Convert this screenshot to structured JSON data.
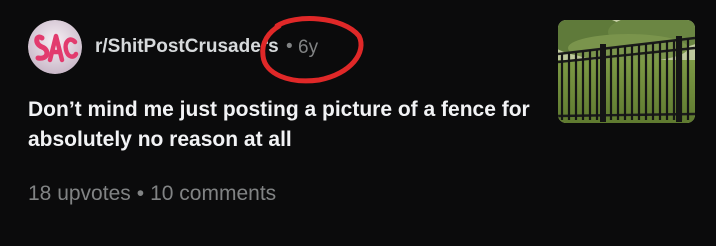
{
  "post": {
    "subreddit": "r/ShitPostCrusaders",
    "age": "6y",
    "title": "Don’t mind me just posting a picture of a fence for absolutely no reason at all",
    "upvotes": "18 upvotes",
    "comments": "10 comments"
  },
  "icons": {
    "avatar": "subreddit-avatar-icon",
    "thumbnail": "fence-thumbnail-image"
  },
  "colors": {
    "background": "#0b0b0c",
    "title": "#f2f3f5",
    "muted": "#818384",
    "annotation": "#e02828"
  }
}
